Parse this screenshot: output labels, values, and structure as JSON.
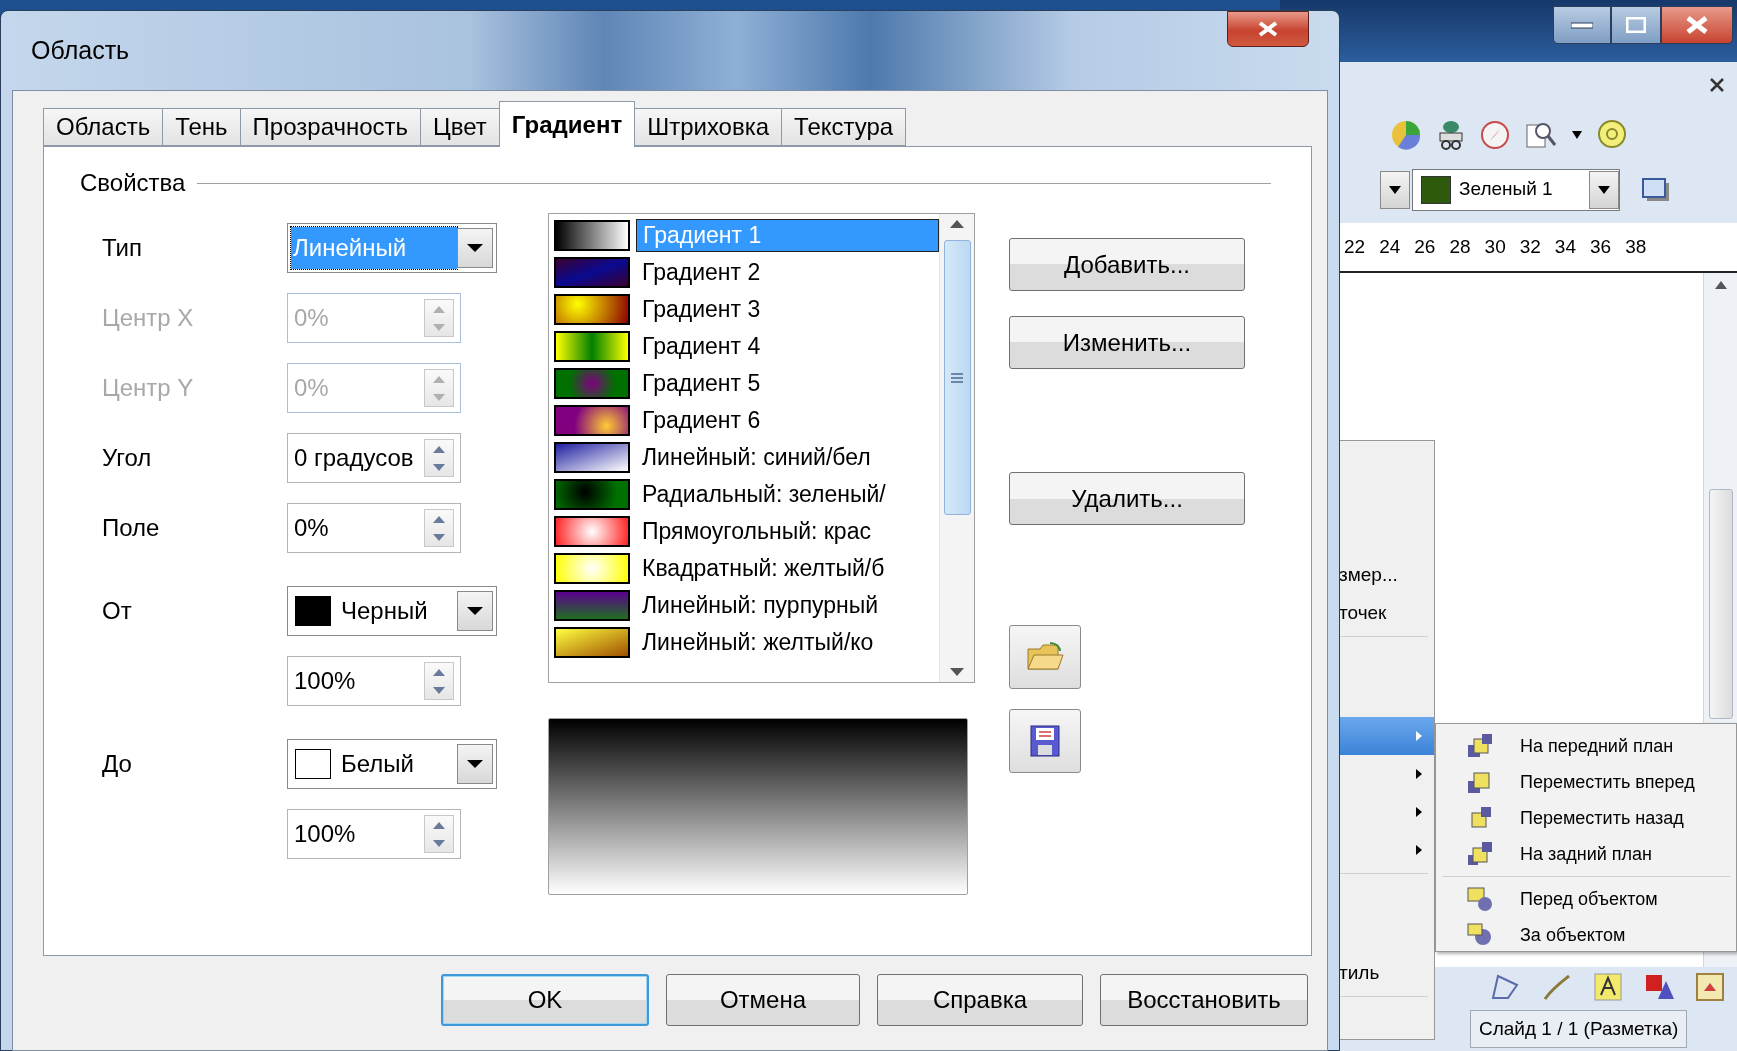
{
  "dialog": {
    "title": "Область"
  },
  "tabs": [
    {
      "label": "Область",
      "selected": false
    },
    {
      "label": "Тень",
      "selected": false
    },
    {
      "label": "Прозрачность",
      "selected": false
    },
    {
      "label": "Цвет",
      "selected": false
    },
    {
      "label": "Градиент",
      "selected": true
    },
    {
      "label": "Штриховка",
      "selected": false
    },
    {
      "label": "Текстура",
      "selected": false
    }
  ],
  "properties": {
    "title": "Свойства",
    "fields": [
      {
        "kind": "dropdown",
        "label": "Тип",
        "value": "Линейный",
        "focused": true
      },
      {
        "kind": "spin",
        "label": "Центр X",
        "value": "0%",
        "disabled": true
      },
      {
        "kind": "spin",
        "label": "Центр Y",
        "value": "0%",
        "disabled": true
      },
      {
        "kind": "spin",
        "label": "Угол",
        "value": "0 градусов",
        "disabled": false
      },
      {
        "kind": "spin",
        "label": "Поле",
        "value": "0%",
        "disabled": false
      },
      {
        "kind": "color",
        "label": "От",
        "value": "Черный",
        "color": "#000000"
      },
      {
        "kind": "spin",
        "value": "100%",
        "disabled": false
      },
      {
        "kind": "color",
        "label": "До",
        "value": "Белый",
        "color": "#ffffff"
      },
      {
        "kind": "spin",
        "value": "100%",
        "disabled": false
      }
    ]
  },
  "gradients": [
    {
      "label": "Градиент 1",
      "selected": true
    },
    {
      "label": "Градиент 2",
      "selected": false
    },
    {
      "label": "Градиент 3",
      "selected": false
    },
    {
      "label": "Градиент 4",
      "selected": false
    },
    {
      "label": "Градиент 5",
      "selected": false
    },
    {
      "label": "Градиент 6",
      "selected": false
    },
    {
      "label": "Линейный: синий/бел",
      "selected": false
    },
    {
      "label": "Радиальный: зеленый/",
      "selected": false
    },
    {
      "label": "Прямоугольный: крас",
      "selected": false
    },
    {
      "label": "Квадратный: желтый/б",
      "selected": false
    },
    {
      "label": "Линейный: пурпурный",
      "selected": false
    },
    {
      "label": "Линейный: желтый/ко",
      "selected": false
    }
  ],
  "side_buttons": [
    {
      "label": "Добавить..."
    },
    {
      "label": "Изменить..."
    },
    {
      "label": "Удалить..."
    }
  ],
  "footer_buttons": [
    {
      "label": "OK",
      "default": true
    },
    {
      "label": "Отмена",
      "default": false
    },
    {
      "label": "Справка",
      "default": false
    },
    {
      "label": "Восстановить",
      "default": false
    }
  ],
  "background_window": {
    "color_box": {
      "value": "Зеленый 1",
      "color": "#2d5a0c"
    },
    "ruler": [
      "22",
      "24",
      "26",
      "28",
      "30",
      "32",
      "34",
      "36",
      "38"
    ],
    "context_menu": [
      {
        "kind": "item",
        "label": "змер...",
        "submenu": false,
        "selected": false
      },
      {
        "kind": "item",
        "label": "точек",
        "submenu": false,
        "selected": false
      },
      {
        "kind": "separator"
      },
      {
        "kind": "item",
        "submenu": false,
        "selected": false
      },
      {
        "kind": "item",
        "submenu": false,
        "selected": false
      },
      {
        "kind": "item",
        "submenu": true,
        "selected": true
      },
      {
        "kind": "item",
        "submenu": true,
        "selected": false
      },
      {
        "kind": "item",
        "submenu": true,
        "selected": false
      },
      {
        "kind": "item",
        "submenu": true,
        "selected": false
      },
      {
        "kind": "separator"
      },
      {
        "kind": "item",
        "submenu": false,
        "selected": false
      },
      {
        "kind": "item",
        "submenu": false,
        "selected": false
      },
      {
        "kind": "item",
        "label": "тиль",
        "submenu": false,
        "selected": false
      },
      {
        "kind": "separator"
      }
    ],
    "submenu": [
      {
        "kind": "item",
        "label": "На передний план"
      },
      {
        "kind": "item",
        "label": "Переместить вперед"
      },
      {
        "kind": "item",
        "label": "Переместить назад"
      },
      {
        "kind": "item",
        "label": "На задний план"
      },
      {
        "kind": "separator"
      },
      {
        "kind": "item",
        "label": "Перед объектом"
      },
      {
        "kind": "item",
        "label": "За объектом"
      }
    ],
    "status": "Слайд 1 / 1 (Разметка)"
  }
}
